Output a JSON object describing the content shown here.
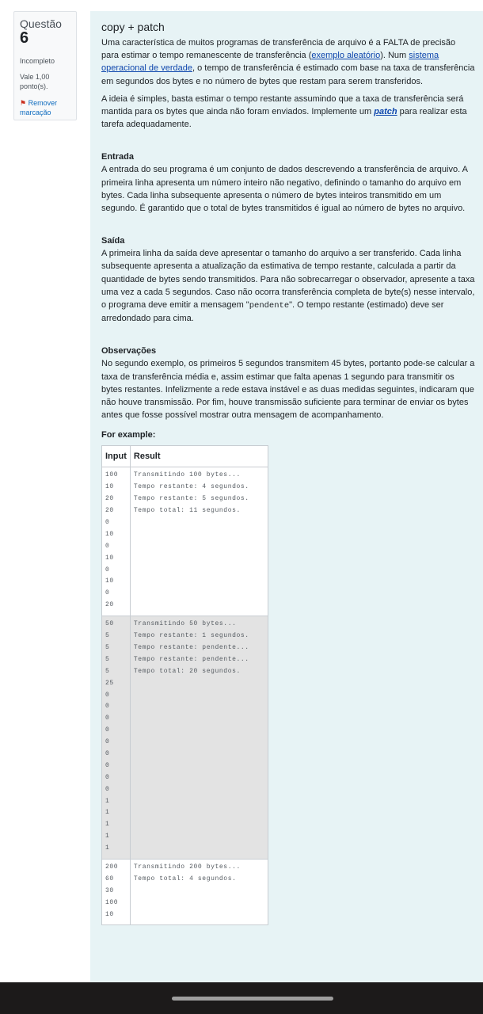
{
  "question_info": {
    "label": "Questão",
    "number": "6",
    "state": "Incompleto",
    "grade": "Vale 1,00 ponto(s).",
    "flag_label": "Remover marcação"
  },
  "content": {
    "title": "copy + patch",
    "intro": {
      "text1": "Uma característica de muitos programas de transferência de arquivo é a FALTA de precisão para estimar o tempo remanescente de transferência (",
      "link1": "exemplo aleatório",
      "text2": "). Num ",
      "link2": "sistema operacional de verdade",
      "text3": ", o tempo de transferência é estimado com base na taxa de transferência em segundos dos bytes e no número de bytes que restam para serem transferidos."
    },
    "idea": {
      "text1": "A ideia é simples, basta estimar o tempo restante assumindo que a taxa de transferência será mantida para os bytes que ainda não foram enviados. Implemente um ",
      "link": "patch",
      "text2": " para realizar esta tarefa adequadamente."
    },
    "entrada": {
      "title": "Entrada",
      "text": "A entrada do seu programa é um conjunto de dados descrevendo a transferência de arquivo. A primeira linha apresenta um número inteiro não negativo, definindo o tamanho do arquivo em bytes. Cada linha subsequente apresenta o número de bytes inteiros transmitido em um segundo. É garantido que o total de bytes transmitidos é igual ao número de bytes no arquivo."
    },
    "saida": {
      "title": "Saída",
      "text1": "A primeira linha da saída deve apresentar o tamanho do arquivo a ser transferido. Cada linha subsequente apresenta a atualização da estimativa de tempo restante, calculada a partir da quantidade de bytes sendo transmitidos. Para não sobrecarregar o observador, apresente a taxa uma vez a cada 5 segundos. Caso não ocorra transferência completa de byte(s) nesse intervalo, o programa deve emitir a mensagem \"",
      "code": "pendente",
      "text2": "\". O tempo restante (estimado) deve ser arredondado para cima."
    },
    "observacoes": {
      "title": "Observações",
      "text": "No segundo exemplo, os primeiros 5 segundos transmitem 45 bytes, portanto pode-se calcular a taxa de transferência média e, assim estimar que falta apenas 1 segundo para transmitir os bytes restantes. Infelizmente a rede estava instável e as duas medidas seguintes, indicaram que não houve transmissão. Por fim, houve transmissão suficiente para terminar de enviar os bytes antes que fosse possível mostrar outra mensagem de acompanhamento."
    },
    "for_example": "For example:",
    "table": {
      "headers": [
        "Input",
        "Result"
      ],
      "rows": [
        {
          "input": [
            "100",
            "10",
            "20",
            "20",
            "0",
            "10",
            "0",
            "10",
            "0",
            "10",
            "0",
            "20"
          ],
          "result": [
            "Transmitindo 100 bytes...",
            "Tempo restante: 4 segundos.",
            "Tempo restante: 5 segundos.",
            "Tempo total: 11 segundos."
          ]
        },
        {
          "input": [
            "50",
            "5",
            "5",
            "5",
            "5",
            "25",
            "0",
            "0",
            "0",
            "0",
            "0",
            "0",
            "0",
            "0",
            "0",
            "1",
            "1",
            "1",
            "1",
            "1"
          ],
          "result": [
            "Transmitindo 50 bytes...",
            "Tempo restante: 1 segundos.",
            "Tempo restante: pendente...",
            "Tempo restante: pendente...",
            "Tempo total: 20 segundos."
          ]
        },
        {
          "input": [
            "200",
            "60",
            "30",
            "100",
            "10"
          ],
          "result": [
            "Transmitindo 200 bytes...",
            "Tempo total: 4 segundos."
          ]
        }
      ]
    }
  }
}
